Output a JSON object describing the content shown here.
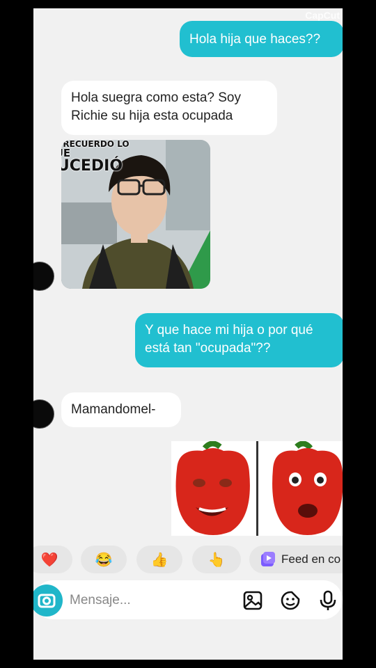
{
  "watermark": "CapCut",
  "messages": [
    {
      "side": "out",
      "text": "Hola hija que haces??"
    },
    {
      "side": "in",
      "text": "Hola suegra como esta? Soy Richie su hija esta ocupada"
    },
    {
      "side": "out",
      "text": "Y que hace mi hija o por qué está tan \"ocupada\"??"
    },
    {
      "side": "in",
      "text": "Mamandomel-"
    }
  ],
  "meme": {
    "line1": "NO RECUERDO LO",
    "line2": "QUE",
    "line3": "SUCEDIÓ"
  },
  "reactions": [
    {
      "icon": "heart-icon",
      "glyph": "❤️"
    },
    {
      "icon": "laughing-emoji-icon",
      "glyph": "😂"
    },
    {
      "icon": "thumbs-up-icon",
      "glyph": "👍"
    },
    {
      "icon": "pointing-hand-icon",
      "glyph": "👆"
    }
  ],
  "feed_label": "Feed en co",
  "input": {
    "placeholder": "Mensaje..."
  },
  "colors": {
    "outgoing": "#21bfd0",
    "incoming": "#ffffff",
    "background": "#f1f1f1"
  }
}
